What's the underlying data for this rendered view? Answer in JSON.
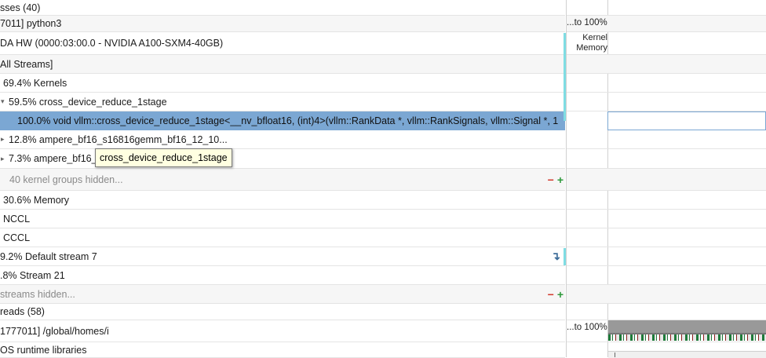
{
  "tree": {
    "rows": [
      {
        "text": "sses (40)",
        "indent": 0,
        "style": "white"
      },
      {
        "text": "7011] python3",
        "indent": 0,
        "style": "alt"
      },
      {
        "text": "DA HW (0000:03:00.0 - NVIDIA A100-SXM4-40GB)",
        "indent": 0,
        "style": "white"
      },
      {
        "text": "All Streams]",
        "indent": 0,
        "style": "alt"
      },
      {
        "text": "69.4% Kernels",
        "indent": 4,
        "style": "white"
      },
      {
        "text": "59.5% cross_device_reduce_1stage",
        "indent": 4,
        "style": "white",
        "triangle": "▾"
      },
      {
        "text": "100.0% void vllm::cross_device_reduce_1stage<__nv_bfloat16, (int)4>(vllm::RankData *, vllm::RankSignals, vllm::Signal *, 1",
        "indent": 22,
        "style": "selected"
      },
      {
        "text": "12.8% ampere_bf16_s16816gemm_bf16_12_10...",
        "indent": 4,
        "style": "white",
        "triangle": "▸"
      },
      {
        "text": "7.3% ampere_bf16_",
        "indent": 4,
        "style": "white",
        "triangle": "▸"
      },
      {
        "text": "40 kernel groups hidden...",
        "indent": 12,
        "style": "alt",
        "dim": true,
        "controls": true
      },
      {
        "text": "30.6% Memory",
        "indent": 4,
        "style": "white"
      },
      {
        "text": "NCCL",
        "indent": 4,
        "style": "white"
      },
      {
        "text": "CCCL",
        "indent": 4,
        "style": "white"
      },
      {
        "text": "9.2% Default stream 7",
        "indent": 0,
        "style": "white",
        "wrap_icon": true
      },
      {
        "text": ".8% Stream 21",
        "indent": 0,
        "style": "white"
      },
      {
        "text": " streams hidden...",
        "indent": 0,
        "style": "alt",
        "dim": true,
        "controls": true
      },
      {
        "text": "reads (58)",
        "indent": 0,
        "style": "white"
      },
      {
        "text": "1777011] /global/homes/i",
        "indent": 0,
        "style": "white"
      },
      {
        "text": "OS runtime libraries",
        "indent": 0,
        "style": "white"
      }
    ]
  },
  "tooltip": {
    "text": "cross_device_reduce_1stage"
  },
  "controls": {
    "minus": "−",
    "plus": "+",
    "wrap": "↴"
  },
  "right_panel": {
    "process_scale": "...to 100%",
    "kernel_memory_line1": "Kernel",
    "kernel_memory_line2": "Memory",
    "threads_scale": "...to 100%"
  },
  "colors": {
    "selection": "#7ba7d3",
    "cyan_marker": "#7fdde3",
    "tooltip_bg": "#ffffe1",
    "minus": "#d23a2e",
    "plus": "#2e9a3b"
  }
}
